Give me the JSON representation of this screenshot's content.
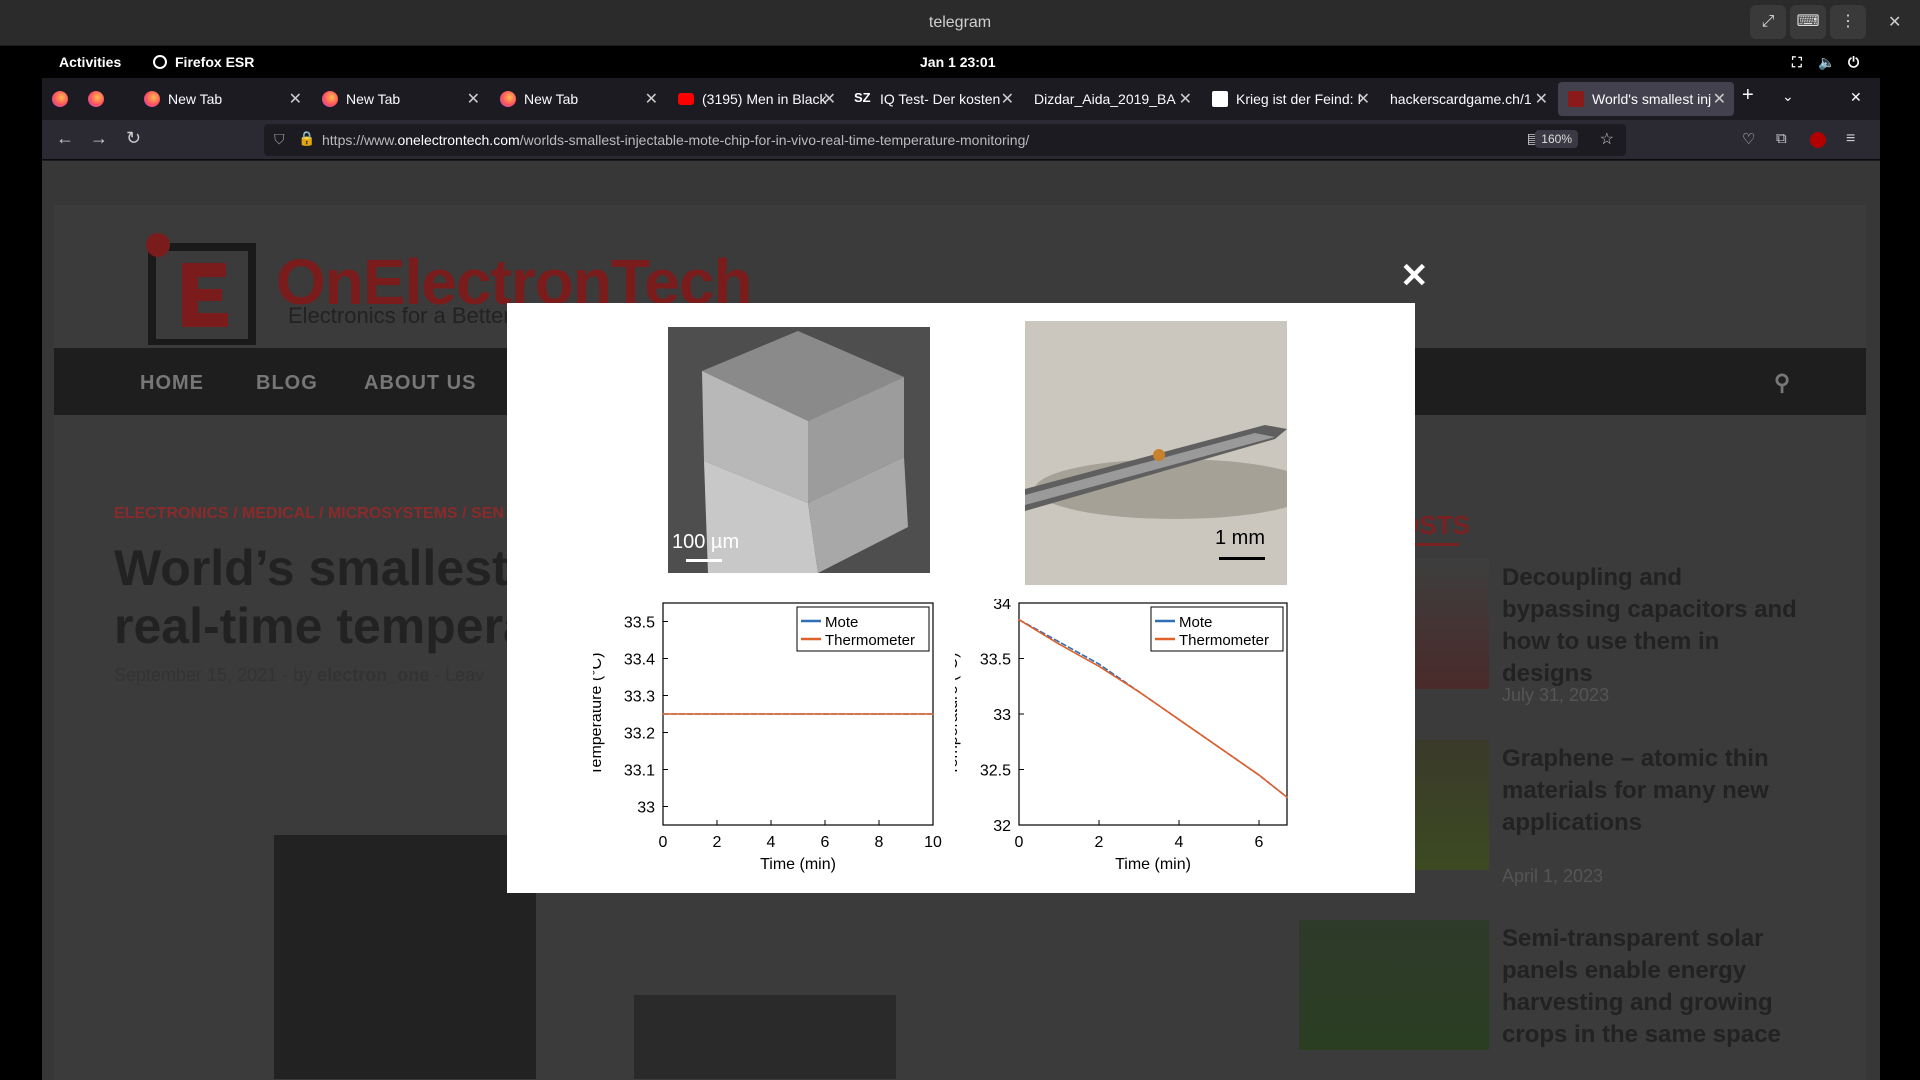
{
  "window": {
    "title": "telegram"
  },
  "topbar": {
    "activities": "Activities",
    "app": "Firefox ESR",
    "clock": "Jan 1  23:01"
  },
  "tabs": [
    {
      "label": "New Tab"
    },
    {
      "label": "New Tab"
    },
    {
      "label": "New Tab"
    },
    {
      "label": "(3195) Men in Black"
    },
    {
      "label": "IQ Test- Der kosten"
    },
    {
      "label": "Dizdar_Aida_2019_BA"
    },
    {
      "label": "Krieg ist der Feind: I"
    },
    {
      "label": "hackerscardgame.ch/1"
    },
    {
      "label": "World's smallest inj"
    }
  ],
  "url": {
    "prefix": "https://www.",
    "domain": "onelectrontech.com",
    "path": "/worlds-smallest-injectable-mote-chip-for-in-vivo-real-time-temperature-monitoring/",
    "zoom": "160%"
  },
  "site": {
    "brand": "OnElectronTech",
    "tagline": "Electronics for a Better Life",
    "menu": [
      "HOME",
      "BLOG",
      "ABOUT US"
    ],
    "categories": "ELECTRONICS / MEDICAL / MICROSYSTEMS / SEN",
    "title": "World’s smallest in real-time tempera",
    "date": "September 15, 2021",
    "by": "by",
    "author": "electron_one",
    "leave": "Leav",
    "recent_heading": "OSTS",
    "recent": [
      {
        "title": "Decoupling and bypassing capacitors and how to use them in designs",
        "date": "July 31, 2023"
      },
      {
        "title": "Graphene – atomic thin materials for many new applications",
        "date": "April 1, 2023"
      },
      {
        "title": "Semi-transparent solar panels enable energy harvesting and growing crops in the same space",
        "date": ""
      }
    ]
  },
  "lightbox": {
    "close": "✕",
    "scale_left": "100 µm",
    "scale_right": "1 mm"
  },
  "chart_data": [
    {
      "type": "line",
      "xlabel": "Time (min)",
      "ylabel": "Temperature (°C)",
      "xlim": [
        0,
        10
      ],
      "ylim": [
        32.95,
        33.55
      ],
      "xticks": [
        "0",
        "2",
        "4",
        "6",
        "8",
        "10"
      ],
      "yticks": [
        "33",
        "33.1",
        "33.2",
        "33.3",
        "33.4",
        "33.5"
      ],
      "legend_position": "top-right",
      "series": [
        {
          "name": "Mote",
          "color": "#2e6fb5",
          "x": [
            0,
            1,
            2,
            3,
            4,
            5,
            6,
            7,
            8,
            9,
            10
          ],
          "values": [
            33.25,
            33.25,
            33.25,
            33.25,
            33.25,
            33.25,
            33.25,
            33.25,
            33.25,
            33.25,
            33.25
          ]
        },
        {
          "name": "Thermometer",
          "color": "#e0602a",
          "x": [
            0,
            1,
            2,
            3,
            4,
            5,
            6,
            7,
            8,
            9,
            10
          ],
          "values": [
            33.25,
            33.25,
            33.25,
            33.25,
            33.25,
            33.25,
            33.25,
            33.25,
            33.25,
            33.25,
            33.25
          ]
        }
      ]
    },
    {
      "type": "line",
      "xlabel": "Time (min)",
      "ylabel": "Temperature (°C)",
      "xlim": [
        0,
        6.7
      ],
      "ylim": [
        32,
        34
      ],
      "xticks": [
        "0",
        "2",
        "4",
        "6"
      ],
      "yticks": [
        "32",
        "32.5",
        "33",
        "33.5",
        "34"
      ],
      "legend_position": "top-right",
      "series": [
        {
          "name": "Mote",
          "color": "#2e6fb5",
          "x": [
            0,
            1,
            2,
            3,
            4,
            5,
            6,
            6.7
          ],
          "values": [
            33.85,
            33.65,
            33.45,
            33.2,
            32.95,
            32.7,
            32.45,
            32.25
          ]
        },
        {
          "name": "Thermometer",
          "color": "#e0602a",
          "x": [
            0,
            1,
            2,
            3,
            4,
            5,
            6,
            6.7
          ],
          "values": [
            33.85,
            33.63,
            33.43,
            33.2,
            32.95,
            32.7,
            32.45,
            32.25
          ]
        }
      ]
    }
  ]
}
